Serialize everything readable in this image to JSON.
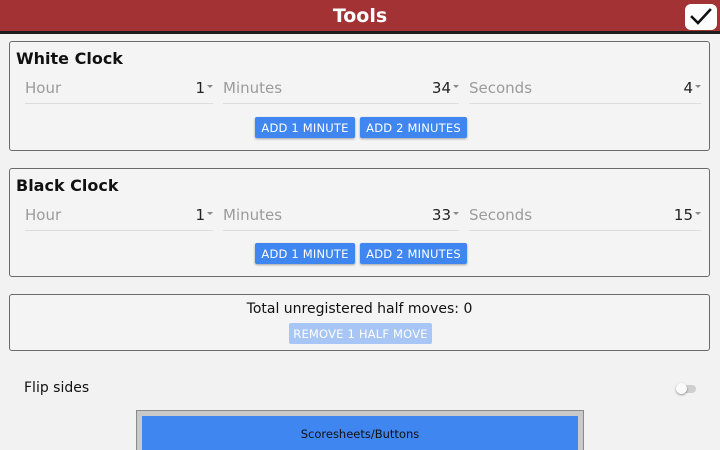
{
  "header": {
    "title": "Tools"
  },
  "white_clock": {
    "title": "White Clock",
    "hour": {
      "label": "Hour",
      "value": "1"
    },
    "minutes": {
      "label": "Minutes",
      "value": "34"
    },
    "seconds": {
      "label": "Seconds",
      "value": "4"
    },
    "add1_label": "ADD 1 MINUTE",
    "add2_label": "ADD 2 MINUTES"
  },
  "black_clock": {
    "title": "Black Clock",
    "hour": {
      "label": "Hour",
      "value": "1"
    },
    "minutes": {
      "label": "Minutes",
      "value": "33"
    },
    "seconds": {
      "label": "Seconds",
      "value": "15"
    },
    "add1_label": "ADD 1 MINUTE",
    "add2_label": "ADD 2 MINUTES"
  },
  "half_moves": {
    "text": "Total unregistered half moves: 0",
    "remove_label": "REMOVE 1 HALF MOVE"
  },
  "flip": {
    "label": "Flip sides",
    "on": false
  },
  "scoresheets": {
    "label": "Scoresheets/Buttons"
  },
  "colors": {
    "header": "#a33234",
    "button": "#3f86f0",
    "button_disabled": "#a7c6f6"
  }
}
